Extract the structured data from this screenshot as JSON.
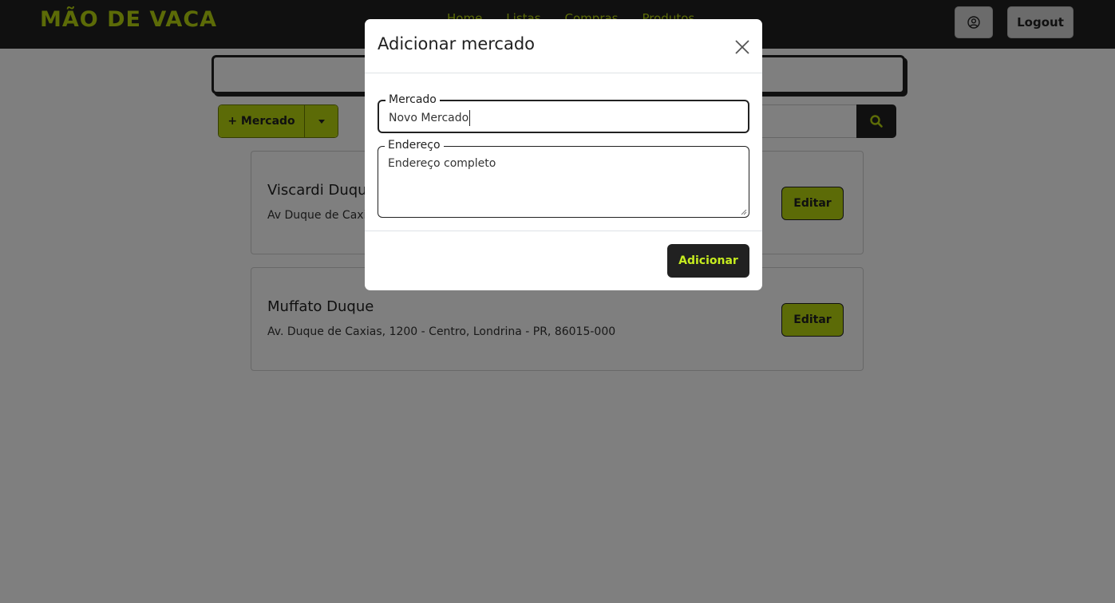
{
  "navbar": {
    "brand": "MÃO DE VACA",
    "links": [
      "Home",
      "Listas",
      "Compras",
      "Produtos"
    ],
    "profile_icon": "user-circle-icon",
    "logout_label": "Logout"
  },
  "toolbar": {
    "add_market_label": "+ Mercado",
    "dropdown_icon": "caret-down-icon",
    "search_icon": "search-icon"
  },
  "markets": [
    {
      "name": "Viscardi Duque",
      "address": "Av Duque de Caxias",
      "edit_label": "Editar"
    },
    {
      "name": "Muffato Duque",
      "address": "Av. Duque de Caxias, 1200 - Centro, Londrina - PR, 86015-000",
      "edit_label": "Editar"
    }
  ],
  "modal": {
    "title": "Adicionar mercado",
    "close_icon": "close-icon",
    "fields": {
      "mercado": {
        "label": "Mercado",
        "value": "Novo Mercado"
      },
      "endereco": {
        "label": "Endereço",
        "placeholder": "Endereço completo"
      }
    },
    "submit_label": "Adicionar"
  },
  "colors": {
    "accent": "#b8d60f",
    "dark": "#212121",
    "backdrop": "rgba(0,0,0,0.5)"
  }
}
